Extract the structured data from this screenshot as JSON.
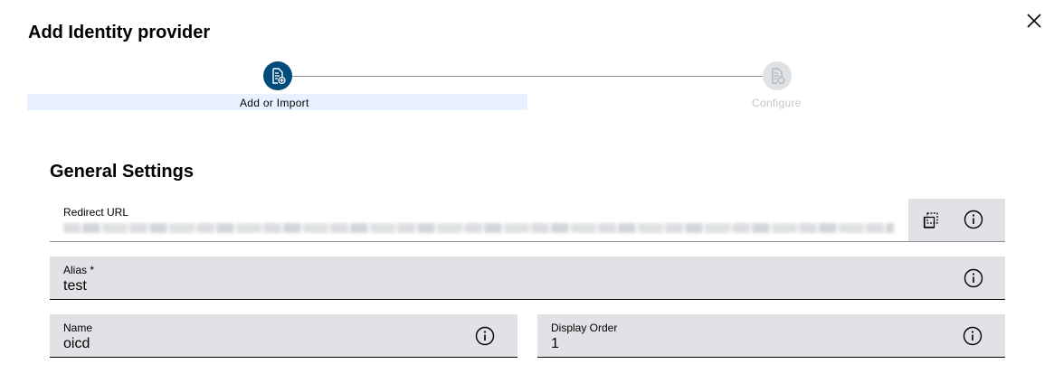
{
  "dialog": {
    "title": "Add Identity provider"
  },
  "stepper": {
    "steps": [
      {
        "label": "Add or Import",
        "state": "active",
        "icon": "document-add-icon"
      },
      {
        "label": "Configure",
        "state": "disabled",
        "icon": "document-settings-icon"
      }
    ],
    "active_color": "#004b7a",
    "disabled_color": "#dfe2e4"
  },
  "general": {
    "title": "General Settings",
    "redirect_url": {
      "label": "Redirect URL"
    },
    "alias": {
      "label": "Alias *",
      "value": "test"
    },
    "name": {
      "label": "Name",
      "value": "oicd"
    },
    "display_order": {
      "label": "Display Order",
      "value": "1"
    }
  },
  "icons": [
    "close-icon",
    "copy-icon",
    "info-icon"
  ],
  "colors": {
    "field_bg": "#e0e2e5",
    "active_step_bg": "#e8f1ff"
  }
}
